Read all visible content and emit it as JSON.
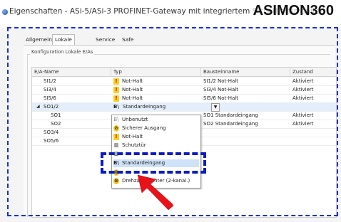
{
  "window": {
    "title": "Eigenschaften - ASi-5/ASi-3 PROFINET-Gateway mit integriertem Sicherheitsmonitor",
    "brand": "ASIMON360"
  },
  "tabs": [
    {
      "label": "Allgemein"
    },
    {
      "label": "Lokale E/As",
      "active": true
    },
    {
      "label": "Service"
    },
    {
      "label": "Safe Link"
    }
  ],
  "group": {
    "label": "Konfiguration Lokale E/As"
  },
  "grid": {
    "headers": [
      "E/A-Name",
      "Typ",
      "Bausteinname",
      "Zustand"
    ],
    "rows": [
      {
        "name": "SI1/2",
        "type": "Not-Halt",
        "icon": "emergency-stop-icon",
        "block": "SI1/2 Not-Halt",
        "state": "Aktiviert"
      },
      {
        "name": "SI3/4",
        "type": "Not-Halt",
        "icon": "emergency-stop-icon",
        "block": "SI3/4 Not-Halt",
        "state": "Aktiviert"
      },
      {
        "name": "SI5/6",
        "type": "Not-Halt",
        "icon": "emergency-stop-icon",
        "block": "SI5/6 Not-Halt",
        "state": "Aktiviert"
      },
      {
        "name": "SO1/2",
        "type": "Standardeingang",
        "icon": "standard-input-icon",
        "block": "",
        "state": "",
        "expanded": true,
        "selected": true
      },
      {
        "name": "SO1",
        "type": "",
        "icon": "",
        "block": "SO1 Standardeingang",
        "state": "Aktiviert"
      },
      {
        "name": "SO2",
        "type": "",
        "icon": "",
        "block": "SO2 Standardeingang",
        "state": "Aktiviert"
      },
      {
        "name": "SO3/4",
        "type": "",
        "icon": "",
        "block": "",
        "state": ""
      },
      {
        "name": "SO5/6",
        "type": "",
        "icon": "",
        "block": "",
        "state": ""
      }
    ]
  },
  "dropdown": {
    "items": [
      {
        "label": "Unbenutzt",
        "icon": "unused-icon"
      },
      {
        "label": "Sicherer Ausgang",
        "icon": "safe-output-icon"
      },
      {
        "label": "Not-Halt",
        "icon": "emergency-stop-icon"
      },
      {
        "label": "Schutztür",
        "icon": "protective-door-icon"
      },
      {
        "label": "",
        "icon": "hidden-option-icon"
      },
      {
        "label": "Standardeingang",
        "icon": "standard-input-icon",
        "highlighted": true
      },
      {
        "label": "",
        "icon": "speed-monitor-icon"
      },
      {
        "label": "Drehzahlwächter (2-kanal.)",
        "icon": "speed-monitor-icon"
      }
    ]
  },
  "colors": {
    "annotation": "#1a2fd1",
    "arrow": "#e8121a",
    "notHalt": "#f7d11e",
    "selection": "#e4eefb"
  }
}
